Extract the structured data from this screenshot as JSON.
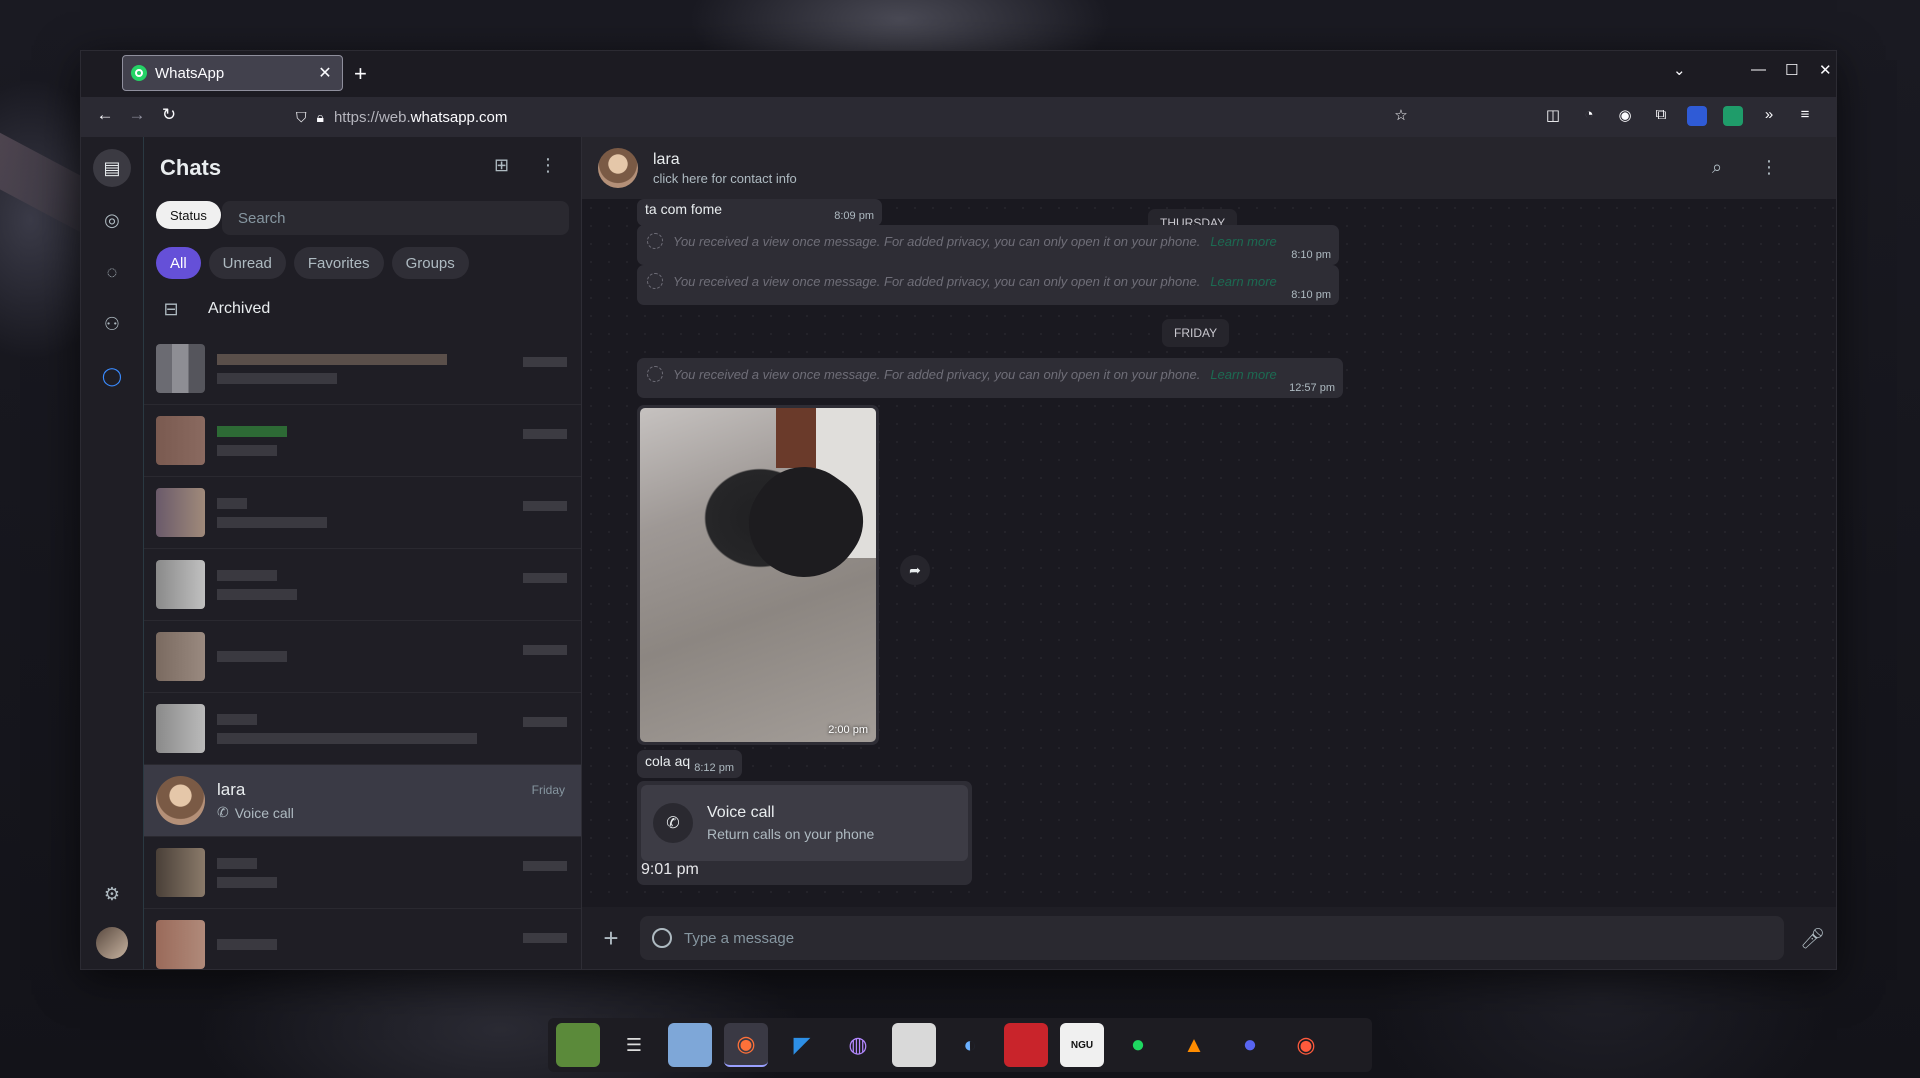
{
  "browser": {
    "tab_title": "WhatsApp",
    "url_prefix": "https://web.",
    "url_domain": "whatsapp.com",
    "window_controls": [
      "⌄",
      "—",
      "☐",
      "✕"
    ]
  },
  "sidebar": {
    "title": "Chats",
    "status_label": "Status",
    "search_placeholder": "Search",
    "filters": [
      "All",
      "Unread",
      "Favorites",
      "Groups"
    ],
    "archived_label": "Archived",
    "selected_chat": {
      "name": "lara",
      "subtitle": "Voice call",
      "time": "Friday"
    }
  },
  "conversation": {
    "contact_name": "lara",
    "contact_subtitle": "click here for contact info",
    "messages": {
      "msg1_text": "ta com fome",
      "msg1_time": "8:09 pm",
      "day1": "THURSDAY",
      "viewonce_text": "You received a view once message. For added privacy, you can only open it on your phone.",
      "learn_more": "Learn more",
      "vo1_time": "8:10 pm",
      "vo2_time": "8:10 pm",
      "day2": "FRIDAY",
      "vo3_time": "12:57 pm",
      "photo_time": "2:00 pm",
      "msg2_text": "cola aq",
      "msg2_time": "8:12 pm",
      "call_title": "Voice call",
      "call_sub": "Return calls on your phone",
      "call_time": "9:01 pm"
    },
    "composer_placeholder": "Type a message"
  },
  "taskbar": {
    "apps": [
      "minecraft",
      "settings",
      "files",
      "firefox",
      "vscode",
      "github",
      "calculator",
      "steam",
      "mega",
      "NGU",
      "spotify",
      "arc",
      "discord",
      "firefox-dev"
    ]
  }
}
